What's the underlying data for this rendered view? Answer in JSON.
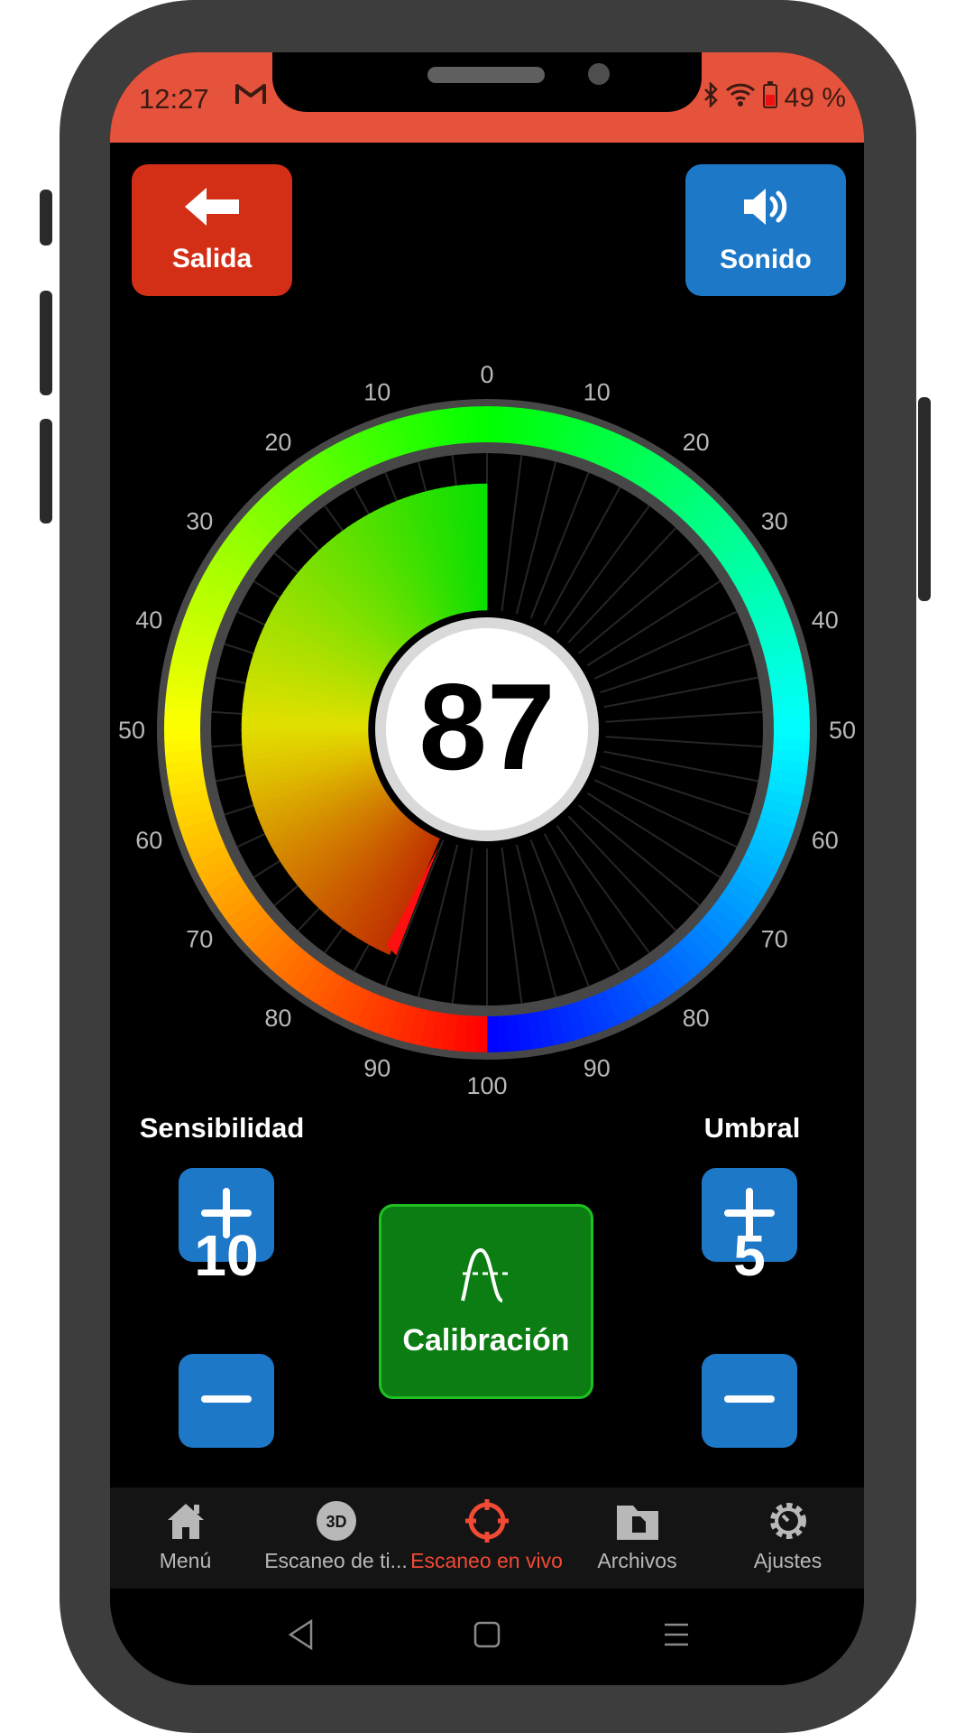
{
  "status_bar": {
    "time": "12:27",
    "battery": "49 %"
  },
  "header": {
    "exit_label": "Salida",
    "sound_label": "Sonido"
  },
  "gauge": {
    "value": "87",
    "value_fraction": 0.87,
    "ticks_left": [
      "10",
      "20",
      "30",
      "40",
      "50",
      "60",
      "70",
      "80",
      "90"
    ],
    "ticks_right": [
      "10",
      "20",
      "30",
      "40",
      "50",
      "60",
      "70",
      "80",
      "90"
    ],
    "tick_top": "0",
    "tick_bottom": "100",
    "colors": {
      "green": "#00ff00",
      "cyan": "#00ffff",
      "blue": "#0010ff",
      "red": "#ff0000",
      "yellow": "#ffff00"
    }
  },
  "controls": {
    "sensitivity": {
      "label": "Sensibilidad",
      "value": "10"
    },
    "threshold": {
      "label": "Umbral",
      "value": "5"
    },
    "calibration_label": "Calibración"
  },
  "nav": {
    "items": [
      {
        "label": "Menú",
        "icon": "home-icon"
      },
      {
        "label": "Escaneo de ti...",
        "icon": "3d-icon"
      },
      {
        "label": "Escaneo en vivo",
        "icon": "crosshair-icon"
      },
      {
        "label": "Archivos",
        "icon": "folder-icon"
      },
      {
        "label": "Ajustes",
        "icon": "gear-icon"
      }
    ],
    "active_index": 2
  },
  "theme": {
    "accent": "#e5533c",
    "primary_button": "#1e78c8",
    "calibration": "#0b7d13"
  }
}
